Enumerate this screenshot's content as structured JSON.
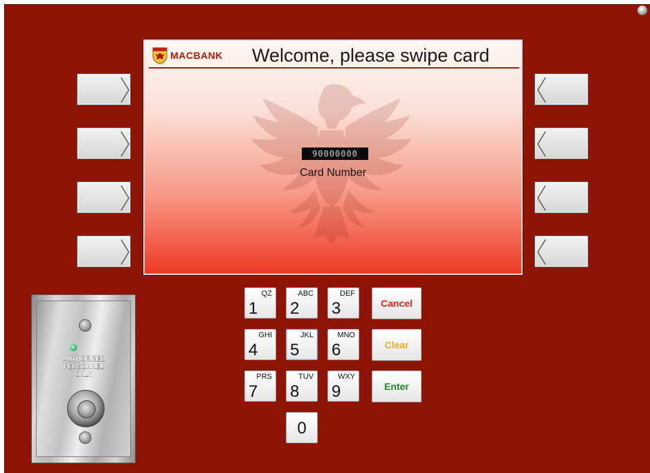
{
  "screen": {
    "brand": "MACBANK",
    "title": "Welcome, please swipe card",
    "card_number_value": "90000000",
    "card_number_label": "Card Number"
  },
  "keypad": {
    "keys": [
      {
        "digit": "1",
        "letters": "QZ"
      },
      {
        "digit": "2",
        "letters": "ABC"
      },
      {
        "digit": "3",
        "letters": "DEF"
      },
      {
        "digit": "4",
        "letters": "GHI"
      },
      {
        "digit": "5",
        "letters": "JKL"
      },
      {
        "digit": "6",
        "letters": "MNO"
      },
      {
        "digit": "7",
        "letters": "PRS"
      },
      {
        "digit": "8",
        "letters": "TUV"
      },
      {
        "digit": "9",
        "letters": "WXY"
      },
      {
        "digit": "0",
        "letters": ""
      }
    ],
    "cancel": "Cancel",
    "clear": "Clear",
    "enter": "Enter"
  },
  "colors": {
    "cancel": "#e8251a",
    "clear": "#f2ad0c",
    "enter": "#1e8a1e",
    "panel": "#8e1505"
  },
  "plate": {
    "lines": [
      "AUTHORIZED",
      "PERSONNEL",
      "ONLY"
    ]
  },
  "icons": {
    "side_left": "chevron-right-icon",
    "side_right": "chevron-left-icon",
    "logo": "eagle-crest-icon",
    "watermark": "eagle-watermark-icon"
  }
}
